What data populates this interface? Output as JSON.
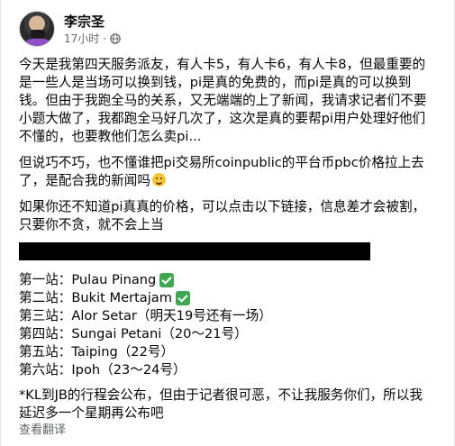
{
  "post": {
    "author": "李宗圣",
    "time": "17小时",
    "dot": "·",
    "paragraph1": [
      "今天是我第四天服务派友，有人卡5，有人卡6，有人卡8，但最重要的",
      "是一些人是当场可以换到钱，pi是真的免费的，而pi是真的可以换到",
      "钱。但由于我跑全马的关系，又无端端的上了新闻，我请求记者们不要",
      "小题大做了，我都跑全马好几次了，这次是真的要帮pi用户处理好他们",
      "不懂的，也要教他们怎么卖pi..."
    ],
    "paragraph2": [
      "但说巧不巧，也不懂谁把pi交易所coinpublic的平台币pbc价格拉上去",
      "了，是配合我的新闻吗"
    ],
    "paragraph3": [
      "如果你还不知道pi真真的价格，可以点击以下链接，信息差才会被割，",
      "只要你不贪，就不会上当"
    ],
    "stops": [
      {
        "text": "第一站：Pulau Pinang",
        "check": true
      },
      {
        "text": "第二站：Bukit Mertajam",
        "check": true
      },
      {
        "text": "第三站：Alor Setar（明天19号还有一场）",
        "check": false
      },
      {
        "text": "第四站：Sungai Petani（20～21号）",
        "check": false
      },
      {
        "text": "第五站：Taiping（22号）",
        "check": false
      },
      {
        "text": "第六站：Ipoh（23～24号）",
        "check": false
      }
    ],
    "paragraph4": [
      "*KL到JB的行程会公布，但由于记者很可恶，不让我服务你们，所以我",
      "延迟多一个星期再公布吧"
    ],
    "see_translation": "查看翻译",
    "icons": {
      "globe": "globe-icon",
      "check": "check-mark-icon",
      "smile": "smiling-face-emoji"
    },
    "colors": {
      "text": "#050505",
      "secondary": "#65676b",
      "check": "#3fa652"
    }
  }
}
